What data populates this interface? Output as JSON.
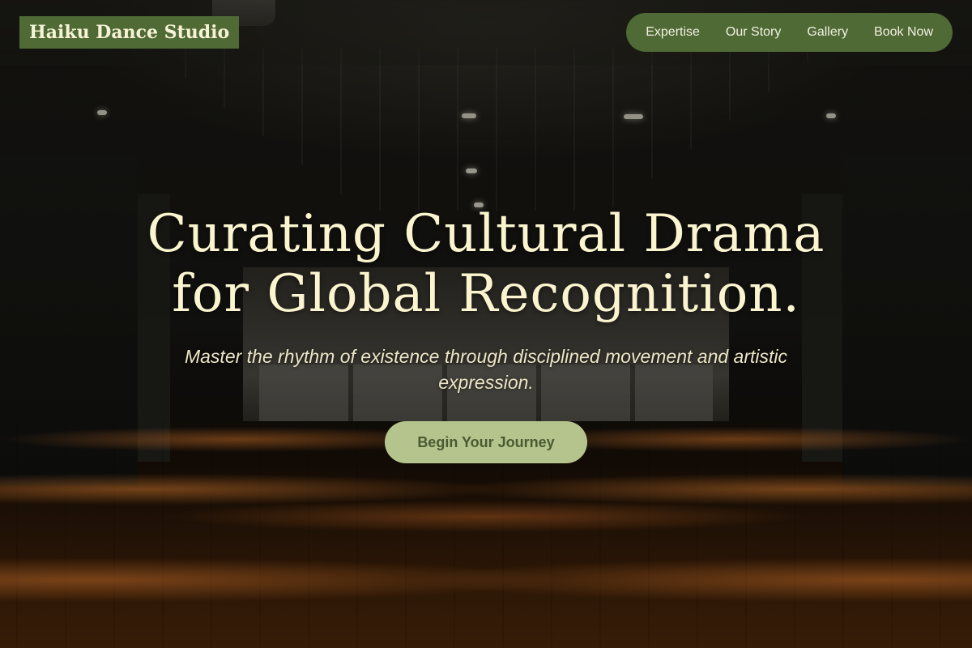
{
  "brand": {
    "name": "Haiku Dance Studio"
  },
  "nav": {
    "items": [
      {
        "label": "Expertise"
      },
      {
        "label": "Our Story"
      },
      {
        "label": "Gallery"
      },
      {
        "label": "Book Now"
      }
    ]
  },
  "hero": {
    "headline_line1": "Curating Cultural Drama",
    "headline_line2": "for Global Recognition.",
    "subheading": "Master the rhythm of existence through disciplined movement and artistic expression.",
    "cta_label": "Begin Your Journey"
  },
  "colors": {
    "brand_green": "#4f6a35",
    "cta_green": "#b4c48c",
    "headline_cream": "#fbf5cf"
  }
}
